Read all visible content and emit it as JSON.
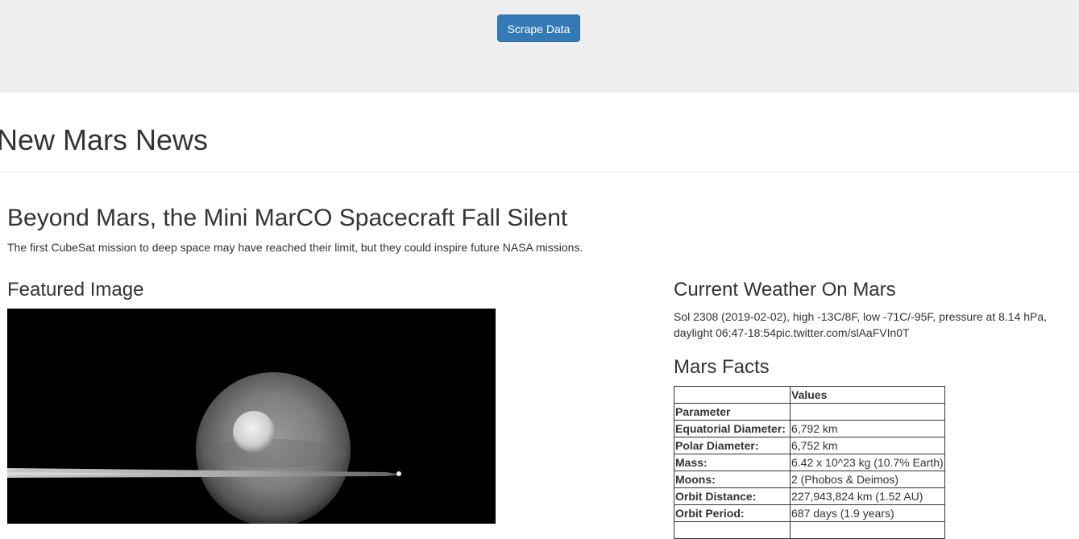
{
  "jumbotron": {
    "button_label": "Scrape Data"
  },
  "page": {
    "title": "New Mars News"
  },
  "news": {
    "title": "Beyond Mars, the Mini MarCO Spacecraft Fall Silent",
    "teaser": "The first CubeSat mission to deep space may have reached their limit, but they could inspire future NASA missions."
  },
  "featured": {
    "heading": "Featured Image",
    "image_subject": "saturn-rings-moons-photo"
  },
  "weather": {
    "heading": "Current Weather On Mars",
    "text": "Sol 2308 (2019-02-02), high -13C/8F, low -71C/-95F, pressure at 8.14 hPa, daylight 06:47-18:54pic.twitter.com/slAaFVIn0T"
  },
  "facts": {
    "heading": "Mars Facts",
    "column_header": "Values",
    "index_header": "Parameter",
    "rows": [
      {
        "label": "Equatorial Diameter:",
        "value": "6,792 km"
      },
      {
        "label": "Polar Diameter:",
        "value": "6,752 km"
      },
      {
        "label": "Mass:",
        "value": "6.42 x 10^23 kg (10.7% Earth)"
      },
      {
        "label": "Moons:",
        "value": "2 (Phobos & Deimos)"
      },
      {
        "label": "Orbit Distance:",
        "value": "227,943,824 km (1.52 AU)"
      },
      {
        "label": "Orbit Period:",
        "value": "687 days (1.9 years)"
      }
    ]
  },
  "colors": {
    "button": "#337ab7",
    "jumbotron": "#eeeeee",
    "text": "#333333"
  }
}
